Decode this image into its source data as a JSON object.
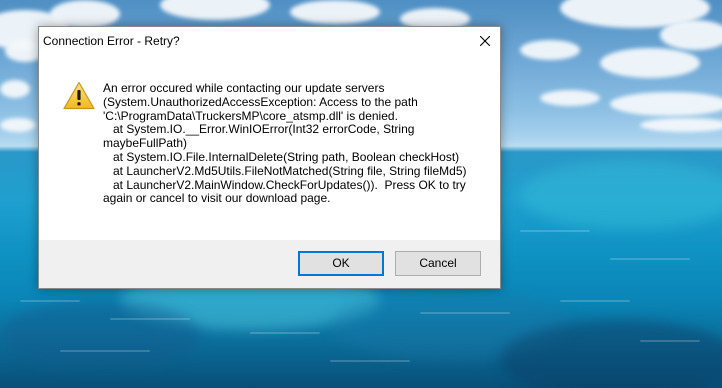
{
  "dialog": {
    "title": "Connection Error - Retry?",
    "icon": "warning-icon",
    "message": "An error occured while contacting our update servers\n(System.UnauthorizedAccessException: Access to the path\n'C:\\ProgramData\\TruckersMP\\core_atsmp.dll' is denied.\n   at System.IO.__Error.WinIOError(Int32 errorCode, String\nmaybeFullPath)\n   at System.IO.File.InternalDelete(String path, Boolean checkHost)\n   at LauncherV2.Md5Utils.FileNotMatched(String file, String fileMd5)\n   at LauncherV2.MainWindow.CheckForUpdates()).  Press OK to try\nagain or cancel to visit our download page.",
    "buttons": {
      "ok": "OK",
      "cancel": "Cancel"
    }
  },
  "colors": {
    "accent": "#0078d7",
    "warning_fill": "#f6c53a",
    "warning_border": "#b8860b"
  }
}
